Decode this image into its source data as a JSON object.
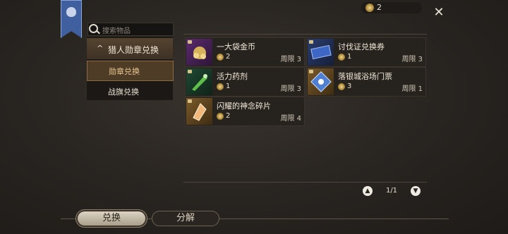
{
  "currency": {
    "amount": "2"
  },
  "search": {
    "placeholder": "搜索物品"
  },
  "nav": {
    "section_title": "猎人勋章兑换",
    "items": [
      {
        "label": "勋章兑换",
        "selected": true
      },
      {
        "label": "战旗兑换",
        "selected": false
      }
    ]
  },
  "items": [
    {
      "name": "一大袋金币",
      "cost": "2",
      "limit": "周限 3",
      "icon": "gold-coin-bag-icon"
    },
    {
      "name": "讨伐证兑换券",
      "cost": "1",
      "limit": "周限 3",
      "icon": "voucher-ticket-icon"
    },
    {
      "name": "活力药剂",
      "cost": "1",
      "limit": "周限 3",
      "icon": "potion-icon"
    },
    {
      "name": "落银城浴场门票",
      "cost": "3",
      "limit": "周限 1",
      "icon": "bath-ticket-icon"
    },
    {
      "name": "闪耀的神念碎片",
      "cost": "2",
      "limit": "周限 4",
      "icon": "shard-icon"
    }
  ],
  "pager": {
    "page": "1/1"
  },
  "bottom_tabs": [
    {
      "label": "兑换",
      "active": true
    },
    {
      "label": "分解",
      "active": false
    }
  ],
  "colors": {
    "accent": "#e6c690",
    "banner": "#3f5f9e"
  }
}
